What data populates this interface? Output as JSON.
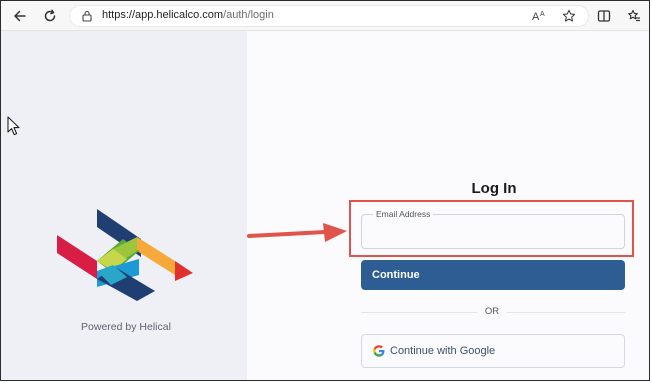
{
  "browser": {
    "url_host": "https://app.helicalco.com",
    "url_path": "/auth/login",
    "read_aloud_label": "Aʾ"
  },
  "left_panel": {
    "powered_by": "Powered by Helical"
  },
  "login": {
    "title": "Log In",
    "email_label": "Email Address",
    "email_value": "",
    "continue_label": "Continue",
    "or_label": "OR",
    "google_label": "Continue with Google"
  },
  "colors": {
    "left_bg": "#eef0f5",
    "right_bg": "#fbfbfd",
    "primary_button": "#2d5d93",
    "annotation_red": "#e0544c"
  },
  "icons": {
    "back": "back-arrow-icon",
    "refresh": "refresh-icon",
    "lock": "lock-icon",
    "read_aloud": "read-aloud-icon",
    "favorite": "star-icon",
    "split": "split-screen-icon",
    "favorites_list": "favorites-list-icon",
    "google": "google-icon",
    "cursor": "mouse-cursor-icon",
    "arrow": "red-arrow-annotation"
  }
}
